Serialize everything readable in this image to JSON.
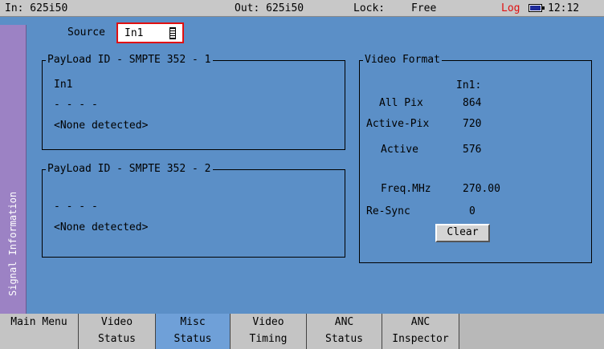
{
  "status": {
    "input": "In: 625i50",
    "output": "Out: 625i50",
    "lock_label": "Lock:",
    "lock_value": "Free",
    "log": "Log",
    "time": "12:12",
    "battery_icon": "battery-icon"
  },
  "side_tab": {
    "label": "Signal Information"
  },
  "source": {
    "label": "Source",
    "value": "In1"
  },
  "payload1": {
    "title": "PayLoad ID - SMPTE 352 - 1",
    "input": "In1",
    "code": "- - - -",
    "status": "<None detected>"
  },
  "payload2": {
    "title": "PayLoad ID - SMPTE 352 - 2",
    "code": "- - - -",
    "status": "<None detected>"
  },
  "video_format": {
    "title": "Video Format",
    "column": "In1:",
    "rows": [
      {
        "label": "All Pix",
        "value": "864"
      },
      {
        "label": "Active-Pix",
        "value": "720"
      },
      {
        "label": "Active",
        "value": "576"
      },
      {
        "label": "Freq.MHz",
        "value": "270.00"
      },
      {
        "label": "Re-Sync",
        "value": "0"
      }
    ],
    "clear_label": "Clear"
  },
  "tabs": [
    {
      "line1": "Main Menu",
      "line2": ""
    },
    {
      "line1": "Video",
      "line2": "Status"
    },
    {
      "line1": "Misc",
      "line2": "Status"
    },
    {
      "line1": "Video",
      "line2": "Timing"
    },
    {
      "line1": "ANC",
      "line2": "Status"
    },
    {
      "line1": "ANC",
      "line2": "Inspector"
    }
  ],
  "colors": {
    "background": "#5b8fc7",
    "side_tab": "#9c82c4",
    "active_tab": "#6fa0d8",
    "highlight": "#e01010"
  }
}
